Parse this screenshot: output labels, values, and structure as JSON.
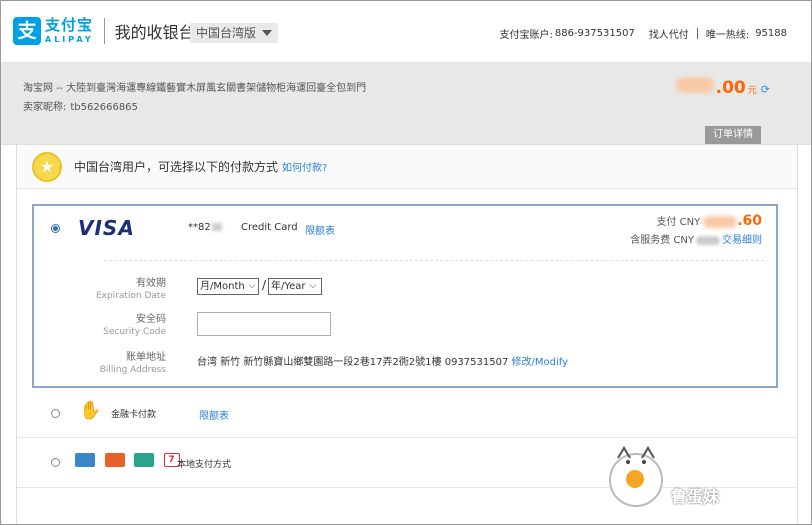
{
  "header": {
    "logo_cn": "支付宝",
    "logo_en": "ALIPAY",
    "page_title": "我的收银台",
    "region": "中国台湾版",
    "account_label": "支付宝账户:",
    "account": "886-937531507",
    "proxy_pay": "找人代付",
    "hotline_label": "唯一热线:",
    "hotline": "95188"
  },
  "order": {
    "title": "淘宝网 -- 大陸到臺灣海運專線鐵藝實木屏風玄關書架儲物柜海運回臺全包到門",
    "seller_label": "卖家昵称:",
    "seller_id": "tb562666865",
    "amount": ".00",
    "amount_unit": "元",
    "detail_tab": "订单详情"
  },
  "notice": {
    "text": "中国台湾用户，可选择以下的付款方式",
    "link": "如何付款?"
  },
  "card": {
    "brand": "VISA",
    "number": "**82",
    "type": "Credit Card",
    "limit_link": "限额表",
    "pay_label": "支付 CNY",
    "pay_amount": ".60",
    "fee_label": "含服务费 CNY",
    "fee_link": "交易细则",
    "expiry_cn": "有效期",
    "expiry_en": "Expiration Date",
    "month": "月/Month",
    "slash": "/",
    "year": "年/Year",
    "code_cn": "安全码",
    "code_en": "Security Code",
    "code_value": "",
    "billing_cn": "账单地址",
    "billing_en": "Billing Address",
    "billing_address": "台湾 新竹 新竹縣寶山鄉雙園路一段2巷17弄2衖2號1樓 0937531507",
    "billing_modify": "修改/Modify"
  },
  "options": [
    {
      "label": "金融卡付款",
      "link": "限额表"
    },
    {
      "label": "本地支付方式"
    }
  ],
  "watermark": "鲁蛋妹",
  "colors": {
    "alipay_blue": "#00a0e9",
    "amount_orange": "#ff6600",
    "link_blue": "#2b7fd4",
    "card_border": "#8ea7c6"
  }
}
